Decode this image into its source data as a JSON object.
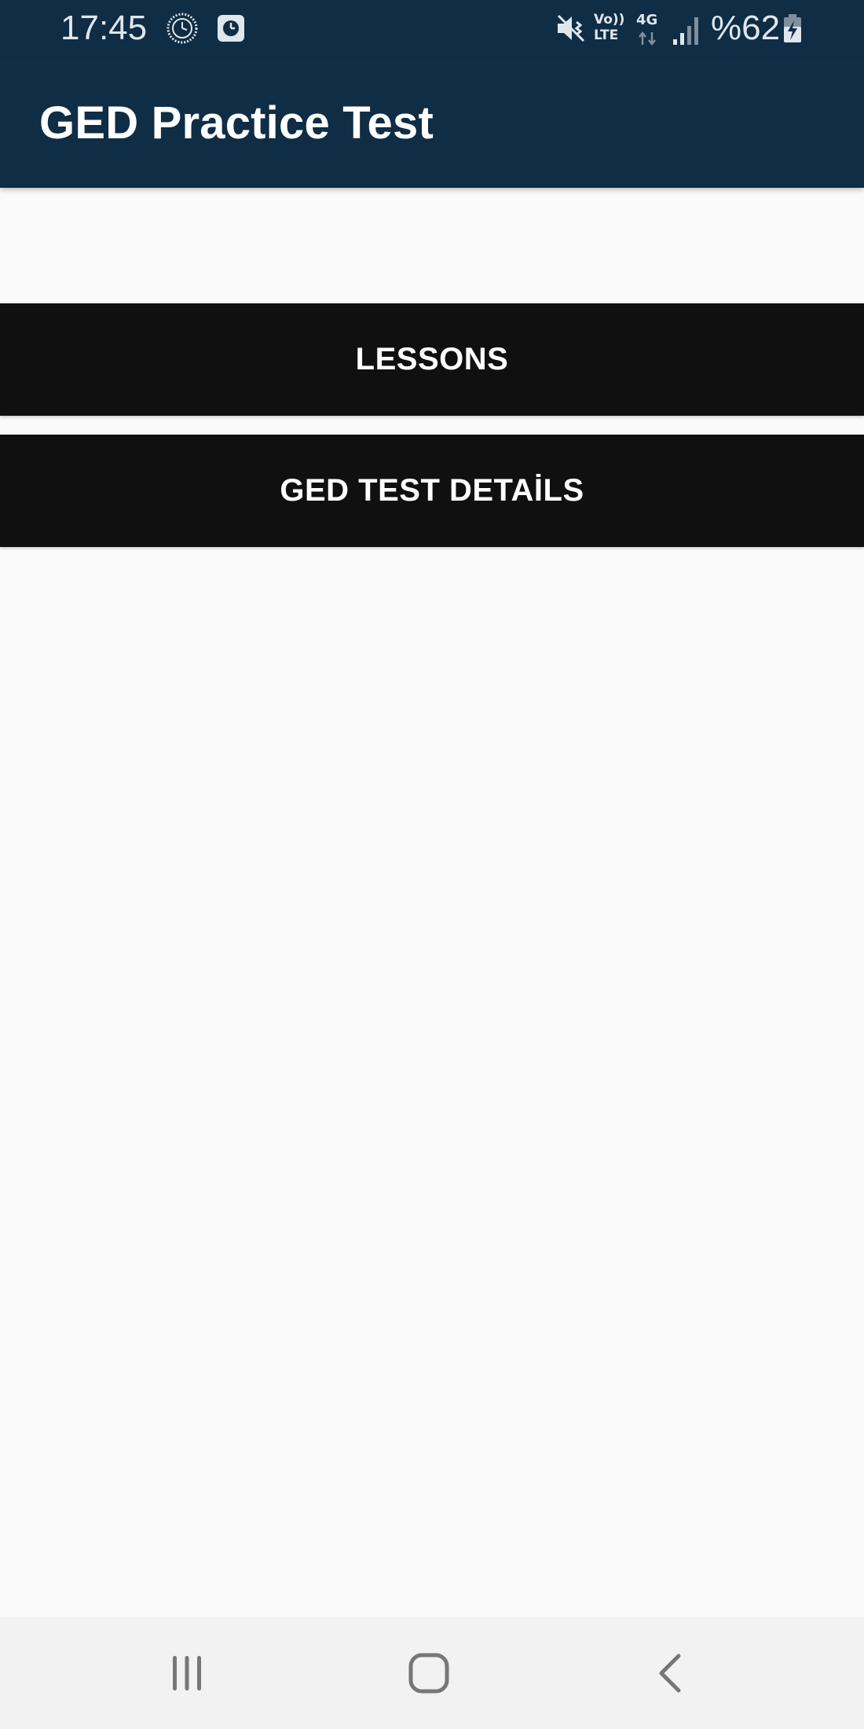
{
  "status_bar": {
    "time": "17:45",
    "network_volte": "Vo))",
    "network_lte": "LTE",
    "network_type": "4G",
    "battery": "%62",
    "icons": [
      "clock-face-icon",
      "alarm-icon",
      "vibrate-mute-icon",
      "volte-icon",
      "data-arrows-icon",
      "signal-icon",
      "battery-charging-icon"
    ]
  },
  "app_bar": {
    "title": "GED Practice Test"
  },
  "menu": {
    "items": [
      {
        "label": "LESSONS"
      },
      {
        "label": "GED TEST DETAİLS"
      }
    ]
  },
  "nav_bar": {
    "icons": [
      "recent-apps-icon",
      "home-icon",
      "back-icon"
    ]
  },
  "colors": {
    "app_bar": "#0f2d45",
    "button_bg": "#101010",
    "button_text": "#ffffff",
    "page_bg": "#fafafa",
    "nav_bar_bg": "#f2f2f2"
  }
}
